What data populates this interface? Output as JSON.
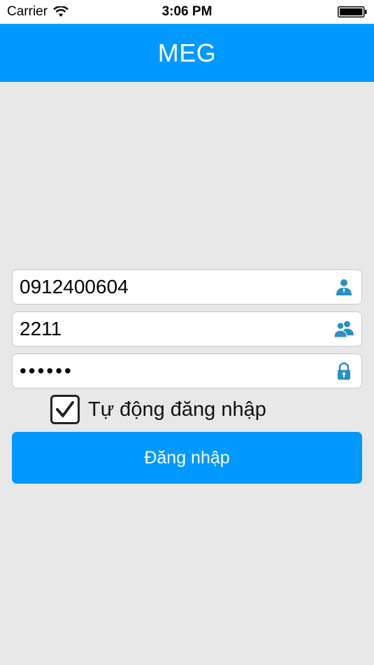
{
  "status_bar": {
    "carrier": "Carrier",
    "time": "3:06 PM",
    "wifi_icon": "wifi-icon",
    "battery_icon": "battery-full-icon"
  },
  "nav": {
    "title": "MEG",
    "background": "#0099ff"
  },
  "form": {
    "phone": {
      "value": "0912400604",
      "icon": "user-icon"
    },
    "code": {
      "value": "2211",
      "icon": "users-icon"
    },
    "password": {
      "value": "••••••",
      "icon": "lock-icon"
    },
    "auto_login": {
      "label": "Tự động đăng nhập",
      "checked": true
    },
    "submit_label": "Đăng nhập"
  },
  "colors": {
    "accent": "#0099ff",
    "icon": "#2a8fc7",
    "background": "#e8e8e8"
  }
}
